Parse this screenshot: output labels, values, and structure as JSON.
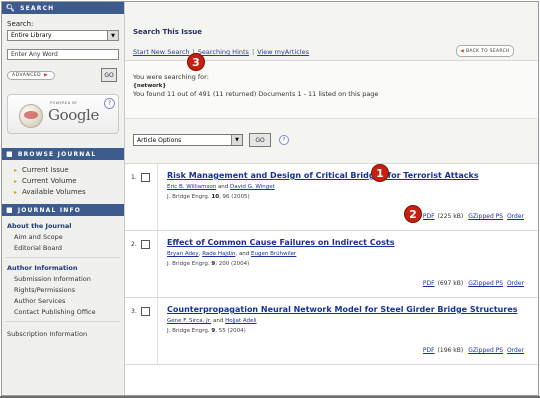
{
  "sidebar": {
    "search_header": "SEARCH",
    "search_label": "Search:",
    "search_scope": "Entire Library",
    "search_input": "Enter Any Word",
    "advanced_label": "ADVANCED",
    "go_label": "GO",
    "google_powered": "POWERED BY",
    "google_word": "Google",
    "help_label": "?",
    "browse_header": "BROWSE JOURNAL",
    "browse_items": [
      "Current Issue",
      "Current Volume",
      "Available Volumes"
    ],
    "info_header": "JOURNAL INFO",
    "about_title": "About the Journal",
    "about_items": [
      "Aim and Scope",
      "Editorial Board"
    ],
    "author_title": "Author Information",
    "author_items": [
      "Submission Information",
      "Rights/Permissions",
      "Author Services",
      "Contact Publishing Office"
    ],
    "cut_item": "Subscription Information"
  },
  "main": {
    "title": "Search This Issue",
    "links": [
      "Start New Search",
      "Searching Hints",
      "View myArticles"
    ],
    "back_button": "BACK TO SEARCH",
    "searching_for_label": "You were searching for:",
    "search_query": "{network}",
    "found_text": "You found 11 out of 491 (11 returned) Documents 1 - 11 listed on this page",
    "options_select": "Article Options",
    "options_go": "GO",
    "options_help": "?"
  },
  "results": [
    {
      "number": "1.",
      "title": "Risk Management and Design of Critical Bridges for Terrorist Attacks",
      "authors": [
        "Eric B. Williamson",
        "David G. Winget"
      ],
      "connector": "and",
      "journal": "J. Bridge Engrg.",
      "volume": "10",
      "pages_year": ", 96 (2005)",
      "pdf_label": "PDF",
      "size": "(225 kB)",
      "gzip_label": "GZipped PS",
      "order_label": "Order"
    },
    {
      "number": "2.",
      "title": "Effect of Common Cause Failures on Indirect Costs",
      "authors": [
        "Bryan Adey",
        "Rade Hajdin",
        "Eugen Brühwiler"
      ],
      "connector": "and",
      "journal": "J. Bridge Engrg.",
      "volume": "9",
      "pages_year": ", 200 (2004)",
      "pdf_label": "PDF",
      "size": "(697 kB)",
      "gzip_label": "GZipped PS",
      "order_label": "Order"
    },
    {
      "number": "3.",
      "title": "Counterpropagation Neural Network Model for Steel Girder Bridge Structures",
      "authors": [
        "Gene F. Sirca, Jr.",
        "Hojjat Adeli"
      ],
      "connector": "and",
      "journal": "J. Bridge Engrg.",
      "volume": "9",
      "pages_year": ", 55 (2004)",
      "pdf_label": "PDF",
      "size": "(196 kB)",
      "gzip_label": "GZipped PS",
      "order_label": "Order"
    }
  ],
  "callouts": [
    "1",
    "2",
    "3"
  ],
  "colors": {
    "header_bar": "#3e5b8e",
    "link_blue": "#16329a",
    "callout_red": "#c8200f"
  }
}
